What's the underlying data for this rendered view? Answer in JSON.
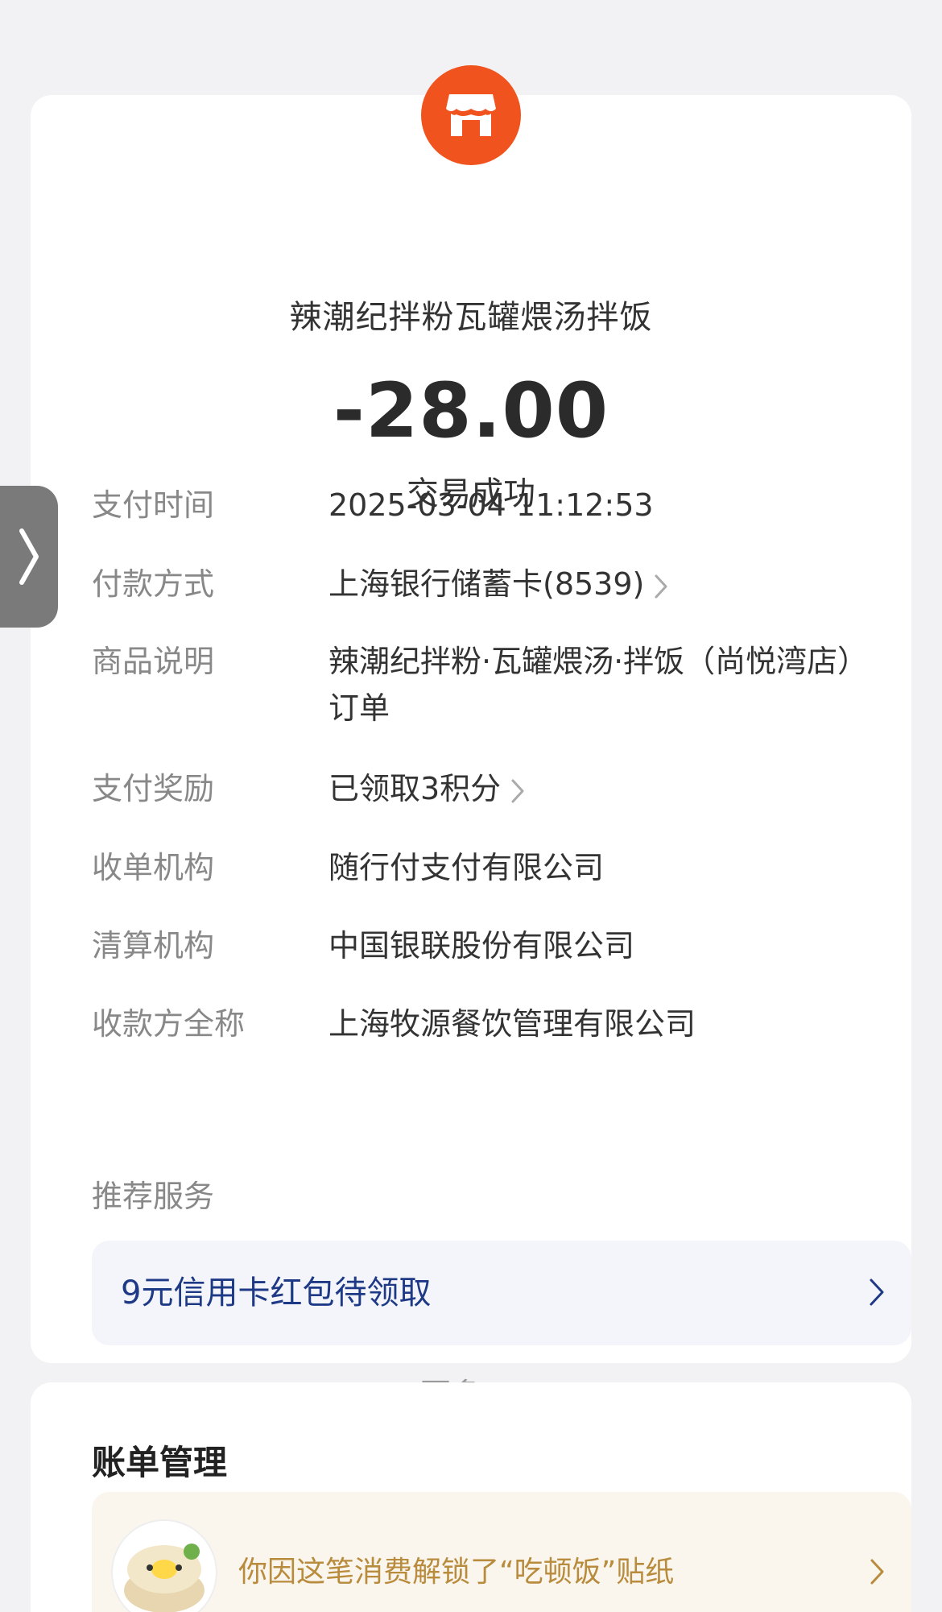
{
  "merchant": {
    "name": "辣潮纪拌粉瓦罐煨汤拌饭",
    "logo_icon": "store-icon",
    "logo_color": "#f0531d"
  },
  "amount": "-28.00",
  "status": "交易成功",
  "details": [
    {
      "label": "支付时间",
      "value": "2025-03-04 11:12:53"
    },
    {
      "label": "付款方式",
      "value": "上海银行储蓄卡(8539)"
    },
    {
      "label": "商品说明",
      "value": "辣潮纪拌粉·瓦罐煨汤·拌饭（尚悦湾店）订单"
    },
    {
      "label": "支付奖励",
      "value": "已领取3积分"
    },
    {
      "label": "收单机构",
      "value": "随行付支付有限公司"
    },
    {
      "label": "清算机构",
      "value": "中国银联股份有限公司"
    },
    {
      "label": "收款方全称",
      "value": "上海牧源餐饮管理有限公司"
    }
  ],
  "recommend": {
    "title": "推荐服务",
    "promo_text": "9元信用卡红包待领取",
    "promo_color": "#1e3a86"
  },
  "more_label": "更多",
  "bill": {
    "title": "账单管理",
    "sticker_text": "你因这笔消费解锁了“吃顿饭”贴纸"
  }
}
